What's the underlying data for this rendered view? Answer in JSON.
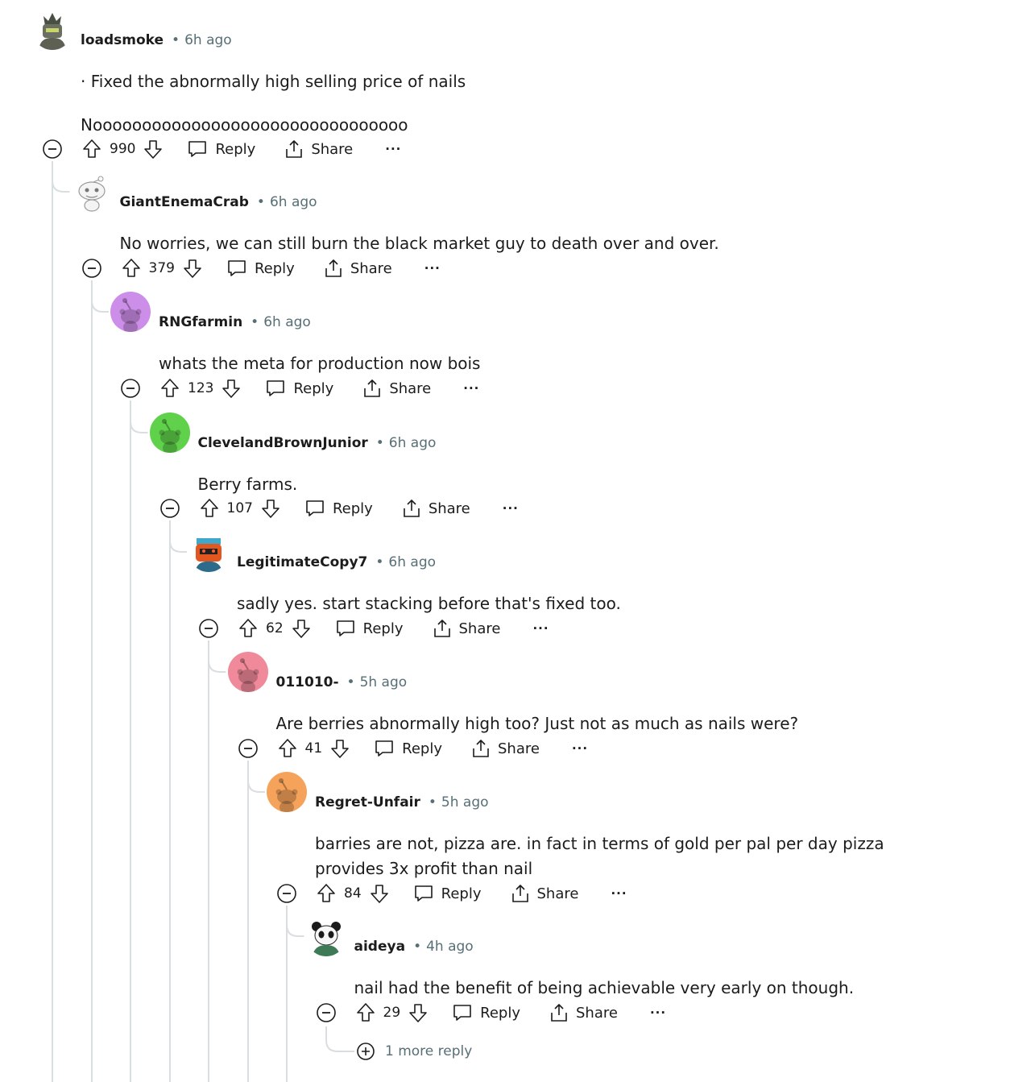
{
  "comments": [
    {
      "author": "loadsmoke",
      "time": "6h ago",
      "body": [
        "· Fixed the abnormally high selling price of nails",
        "Noooooooooooooooooooooooooooooooo"
      ],
      "score": "990",
      "avatar": "robot",
      "avatar_color": "#6b6f62"
    },
    {
      "author": "GiantEnemaCrab",
      "time": "6h ago",
      "body": [
        "No worries, we can still burn the black market guy to death over and over."
      ],
      "score": "379",
      "avatar": "snoo-sketch",
      "avatar_color": "#e8e8e8"
    },
    {
      "author": "RNGfarmin",
      "time": "6h ago",
      "body": [
        "whats the meta for production now bois"
      ],
      "score": "123",
      "avatar": "snoo",
      "avatar_color": "#cc8ee8"
    },
    {
      "author": "ClevelandBrownJunior",
      "time": "6h ago",
      "body": [
        "Berry farms."
      ],
      "score": "107",
      "avatar": "snoo",
      "avatar_color": "#5fd14a"
    },
    {
      "author": "LegitimateCopy7",
      "time": "6h ago",
      "body": [
        "sadly yes. start stacking before that's fixed too."
      ],
      "score": "62",
      "avatar": "robot-orange",
      "avatar_color": "#e2561f"
    },
    {
      "author": "011010-",
      "time": "5h ago",
      "body": [
        "Are berries abnormally high too? Just not as much as nails were?"
      ],
      "score": "41",
      "avatar": "snoo",
      "avatar_color": "#f08a9a"
    },
    {
      "author": "Regret-Unfair",
      "time": "5h ago",
      "body": [
        "barries are not, pizza are. in fact in terms of gold per pal per day pizza provides 3x profit than nail"
      ],
      "score": "84",
      "avatar": "snoo",
      "avatar_color": "#f5a35b"
    },
    {
      "author": "aideya",
      "time": "4h ago",
      "body": [
        "nail had the benefit of being achievable very early on though."
      ],
      "score": "29",
      "avatar": "panda",
      "avatar_color": "#3d7a55"
    }
  ],
  "labels": {
    "reply": "Reply",
    "share": "Share",
    "more": "···",
    "separator": "•",
    "more_replies": "1 more reply"
  },
  "icons": {
    "collapse": "minus-circle-icon",
    "upvote": "arrow-up-icon",
    "downvote": "arrow-down-icon",
    "reply": "speech-bubble-icon",
    "share": "share-icon",
    "more": "ellipsis-icon",
    "expand": "plus-circle-icon"
  },
  "colors": {
    "text": "#1c1c1c",
    "meta": "#576f76",
    "thread_line": "#d9dee0"
  }
}
